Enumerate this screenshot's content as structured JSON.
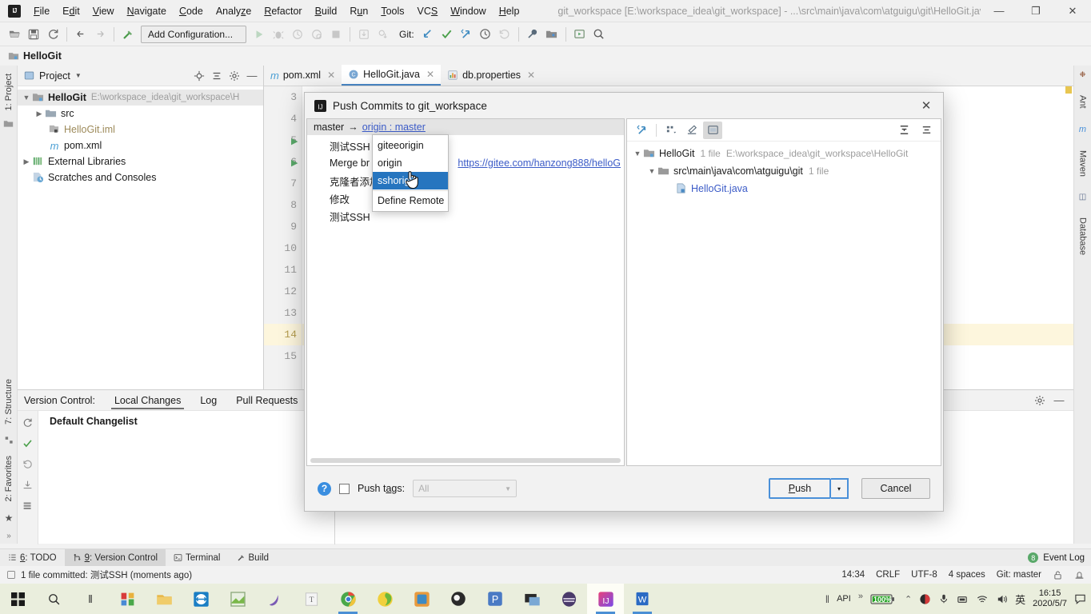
{
  "window": {
    "title": "git_workspace [E:\\workspace_idea\\git_workspace] - ...\\src\\main\\java\\com\\atguigu\\git\\HelloGit.java",
    "minimize": "—",
    "maximize": "❐",
    "close": "✕"
  },
  "menubar": {
    "items": [
      {
        "label": "File"
      },
      {
        "label": "Edit"
      },
      {
        "label": "View"
      },
      {
        "label": "Navigate"
      },
      {
        "label": "Code"
      },
      {
        "label": "Analyze"
      },
      {
        "label": "Refactor"
      },
      {
        "label": "Build"
      },
      {
        "label": "Run"
      },
      {
        "label": "Tools"
      },
      {
        "label": "VCS"
      },
      {
        "label": "Window"
      },
      {
        "label": "Help"
      }
    ]
  },
  "toolbar": {
    "run_config": "Add Configuration...",
    "git_label": "Git:"
  },
  "navbar": {
    "project": "HelloGit"
  },
  "left_strip": {
    "project_tab": "1: Project"
  },
  "right_strip": {
    "items": [
      "Ant",
      "Maven",
      "Database"
    ]
  },
  "bottom_left_strip": {
    "items": [
      "7: Structure",
      "2: Favorites"
    ]
  },
  "project_panel": {
    "header_title": "Project",
    "tree": [
      {
        "label": "HelloGit",
        "path": "E:\\workspace_idea\\git_workspace\\H",
        "depth": 0,
        "icon": "module-icon",
        "bold": true,
        "expanded": true
      },
      {
        "label": "src",
        "path": "",
        "depth": 1,
        "icon": "folder-source-icon",
        "bold": false,
        "expanded": false
      },
      {
        "label": "HelloGit.iml",
        "path": "",
        "depth": 2,
        "icon": "iml-file-icon",
        "bold": false,
        "dim": true
      },
      {
        "label": "pom.xml",
        "path": "",
        "depth": 2,
        "icon": "maven-file-icon",
        "bold": false
      },
      {
        "label": "External Libraries",
        "path": "",
        "depth": 0,
        "icon": "libraries-icon",
        "bold": false,
        "expanded": false
      },
      {
        "label": "Scratches and Consoles",
        "path": "",
        "depth": 0,
        "icon": "scratches-icon",
        "bold": false
      }
    ]
  },
  "editor": {
    "tabs": [
      {
        "label": "pom.xml",
        "icon": "maven-file-icon",
        "active": false
      },
      {
        "label": "HelloGit.java",
        "icon": "java-class-icon",
        "active": true
      },
      {
        "label": "db.properties",
        "icon": "properties-file-icon",
        "active": false
      }
    ],
    "line_numbers": [
      "3",
      "4",
      "5",
      "6",
      "7",
      "8",
      "9",
      "10",
      "11",
      "12",
      "13",
      "14",
      "15"
    ],
    "highlighted_line": "14",
    "run_marker_lines": [
      "5",
      "6"
    ]
  },
  "vcs_panel": {
    "label": "Version Control:",
    "tabs": [
      {
        "label": "Local Changes",
        "active": true
      },
      {
        "label": "Log",
        "active": false
      },
      {
        "label": "Pull Requests",
        "active": false
      }
    ],
    "changelist": "Default Changelist"
  },
  "dialog": {
    "title": "Push Commits to git_workspace",
    "close": "✕",
    "push_head": {
      "branch": "master",
      "arrow": "→",
      "target": "origin : master"
    },
    "commits": [
      {
        "message": "测试SSH",
        "url": ""
      },
      {
        "message": "Merge br",
        "url": "https://gitee.com/hanzong888/helloG"
      },
      {
        "message": "克隆者添加",
        "url": ""
      },
      {
        "message": "修改",
        "url": ""
      },
      {
        "message": "测试SSH",
        "url": ""
      }
    ],
    "files_tree": [
      {
        "label": "HelloGit",
        "count": "1 file",
        "path": "E:\\workspace_idea\\git_workspace\\HelloGit",
        "depth": 0,
        "icon": "module-icon",
        "expanded": true
      },
      {
        "label": "src\\main\\java\\com\\atguigu\\git",
        "count": "1 file",
        "path": "",
        "depth": 1,
        "icon": "folder-icon",
        "expanded": true
      },
      {
        "label": "HelloGit.java",
        "count": "",
        "path": "",
        "depth": 2,
        "icon": "java-class-icon",
        "expanded": false
      }
    ],
    "footer": {
      "help": "?",
      "push_tags_label": "Push tags:",
      "push_tags_checked": false,
      "tag_scope_value": "All",
      "push_button": "Push",
      "push_dropdown_arrow": "▾",
      "cancel_button": "Cancel"
    },
    "remote_popup": {
      "items": [
        {
          "label": "giteeorigin",
          "selected": false
        },
        {
          "label": "origin",
          "selected": false
        },
        {
          "label": "sshorigin",
          "selected": true
        },
        {
          "label": "Define Remote",
          "selected": false
        }
      ]
    }
  },
  "toolwindow_bar": {
    "items": [
      {
        "label": "6: TODO",
        "icon": "todo-icon",
        "active": false
      },
      {
        "label": "9: Version Control",
        "icon": "vcs-icon",
        "active": true
      },
      {
        "label": "Terminal",
        "icon": "terminal-icon",
        "active": false
      },
      {
        "label": "Build",
        "icon": "build-icon",
        "active": false
      }
    ],
    "event_log": "Event Log",
    "event_count": "8"
  },
  "statusbar": {
    "message": "1 file committed: 测试SSH (moments ago)",
    "time": "14:34",
    "line_sep": "CRLF",
    "encoding": "UTF-8",
    "indent": "4 spaces",
    "branch": "Git: master"
  },
  "taskbar": {
    "apps": [
      {
        "name": "start-button",
        "glyph": "⊞"
      },
      {
        "name": "search-icon",
        "glyph": "⌕"
      },
      {
        "name": "task-view-icon",
        "glyph": "‖"
      },
      {
        "name": "windows-store-icon",
        "glyph": ""
      },
      {
        "name": "file-explorer-icon",
        "glyph": ""
      },
      {
        "name": "teamviewer-icon",
        "glyph": ""
      },
      {
        "name": "notepad-icon",
        "glyph": ""
      },
      {
        "name": "navicat-icon",
        "glyph": ""
      },
      {
        "name": "typora-icon",
        "glyph": "T"
      },
      {
        "name": "chrome-icon",
        "glyph": ""
      },
      {
        "name": "tim-icon",
        "glyph": ""
      },
      {
        "name": "app-icon",
        "glyph": ""
      },
      {
        "name": "obs-icon",
        "glyph": ""
      },
      {
        "name": "pycharm-icon",
        "glyph": "P"
      },
      {
        "name": "vm-icon",
        "glyph": ""
      },
      {
        "name": "eclipse-icon",
        "glyph": ""
      },
      {
        "name": "intellij-idea-icon",
        "glyph": "IJ"
      },
      {
        "name": "word-icon",
        "glyph": "W"
      }
    ],
    "tray": {
      "api_label": "API",
      "overflow": "»",
      "battery": "100%",
      "chevron": "⌃",
      "ime": "英",
      "time": "16:15",
      "date": "2020/5/7",
      "action_center": "⬜"
    }
  },
  "colors": {
    "accent": "#4a90d9",
    "link": "#3b5bc7",
    "selection": "#2675bf",
    "green": "#59a869",
    "highlight": "#fdf6dd"
  }
}
